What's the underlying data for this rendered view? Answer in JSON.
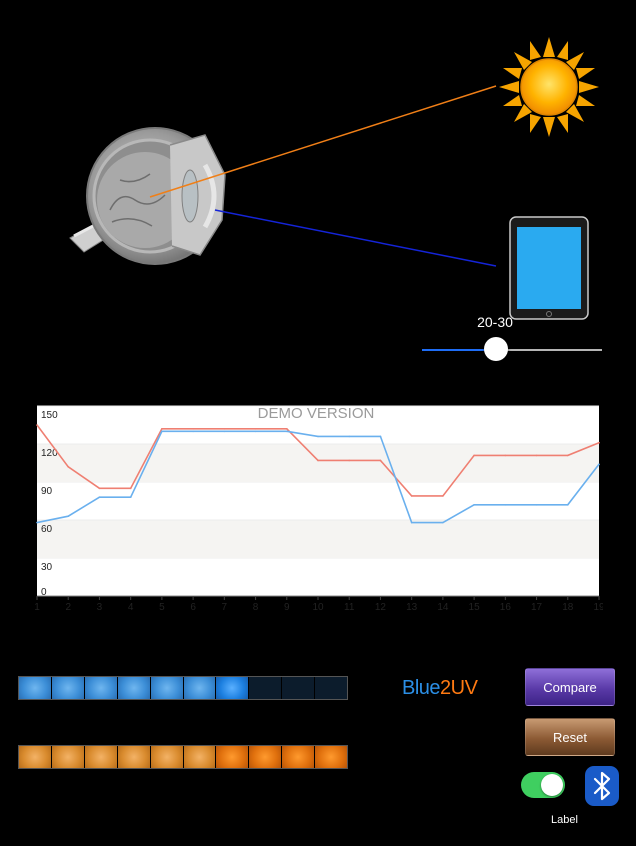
{
  "colors": {
    "sun_ray": "#f07f17",
    "tablet_ray": "#1424d8",
    "series_red": "#ef7f72",
    "series_blue": "#6ab0ee",
    "slider_fill": "#1e6df5",
    "compare_button": "#5a3aa8",
    "reset_button": "#8c5a34",
    "toggle_on": "#3fcf60",
    "bluetooth": "#1a5bc8"
  },
  "icons": {
    "eye": "eye-cross-section-icon",
    "sun": "sun-icon",
    "tablet": "tablet-icon",
    "bluetooth": "bluetooth-icon"
  },
  "age_slider": {
    "label": "20-30",
    "value_fraction": 0.41
  },
  "chart_data": {
    "type": "line",
    "watermark": "DEMO VERSION",
    "x": [
      1,
      2,
      3,
      4,
      5,
      6,
      7,
      8,
      9,
      10,
      11,
      12,
      13,
      14,
      15,
      16,
      17,
      18,
      19
    ],
    "yticks": [
      0,
      30,
      60,
      90,
      120,
      150
    ],
    "ylim": [
      0,
      150
    ],
    "xlim": [
      1,
      19
    ],
    "grid": "horizontal bands",
    "series": [
      {
        "color": "#ef7f72",
        "values": [
          135,
          102,
          85,
          85,
          132,
          132,
          132,
          132,
          132,
          107,
          107,
          107,
          79,
          79,
          111,
          111,
          111,
          111,
          121
        ]
      },
      {
        "color": "#6ab0ee",
        "values": [
          58,
          63,
          78,
          78,
          130,
          130,
          130,
          130,
          130,
          126,
          126,
          126,
          58,
          58,
          72,
          72,
          72,
          72,
          104
        ]
      }
    ]
  },
  "blue_meter": {
    "segments": 10,
    "lit": 7,
    "highlight_index": 6
  },
  "orange_meter": {
    "segments": 10,
    "lit": 10,
    "highlight_start": 6
  },
  "logo": {
    "part1": "Blue",
    "part2": "2UV"
  },
  "buttons": {
    "compare": "Compare",
    "reset": "Reset"
  },
  "toggle": {
    "on": true,
    "label": "Label"
  }
}
